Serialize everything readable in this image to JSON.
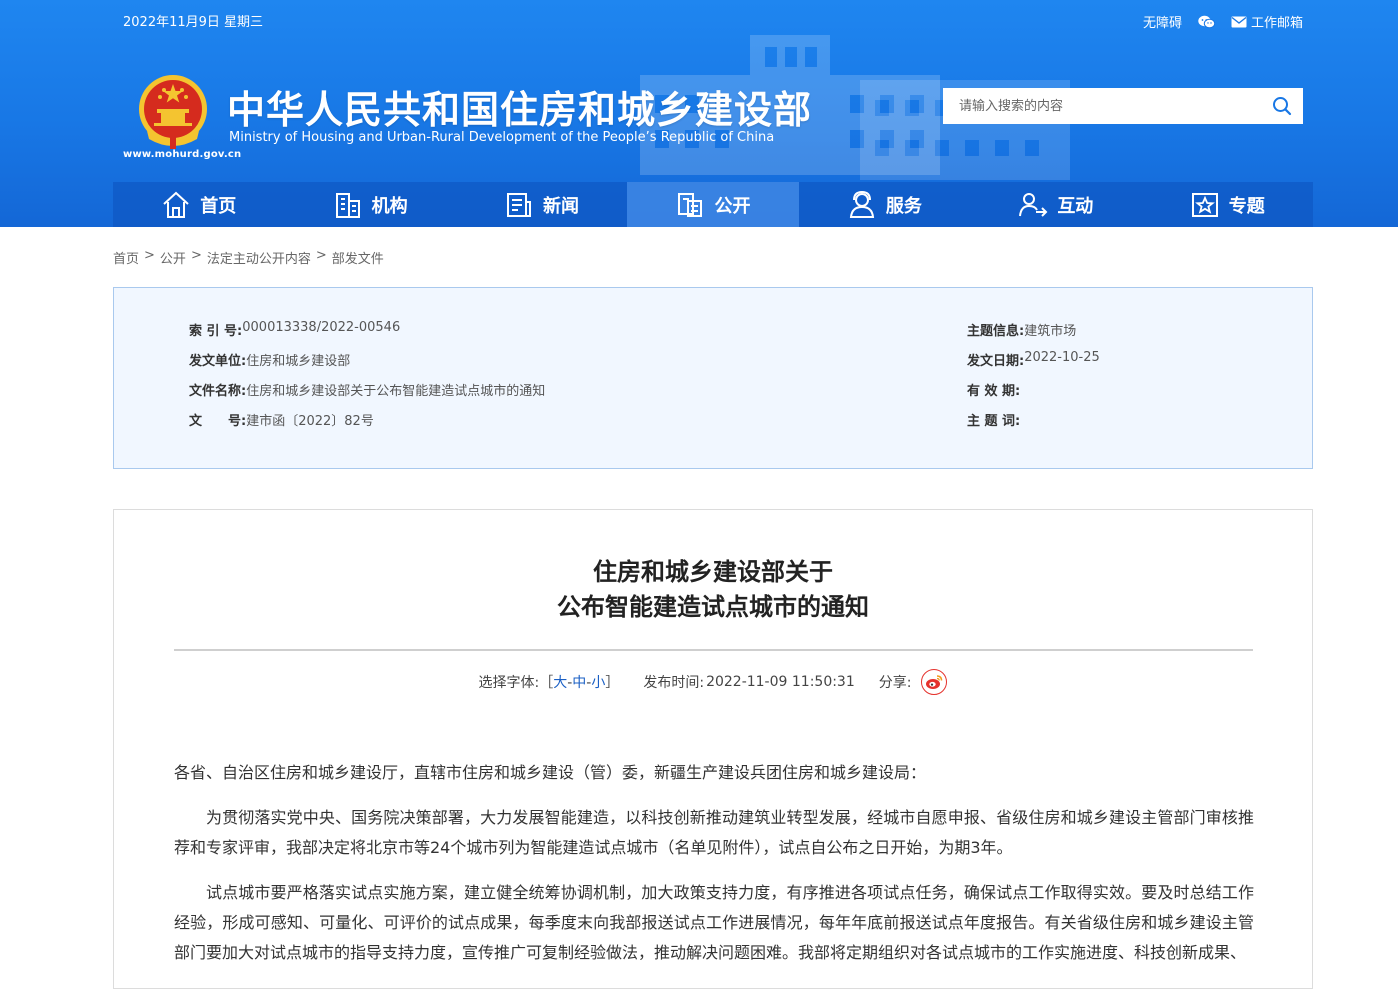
{
  "topbar": {
    "date": "2022年11月9日 星期三",
    "accessibility": "无障碍",
    "wechat_icon": "wechat-icon",
    "mail_label": "工作邮箱"
  },
  "site": {
    "url": "www.mohurd.gov.cn",
    "title_cn": "中华人民共和国住房和城乡建设部",
    "title_en": "Ministry of Housing and Urban-Rural Development of the People’s Republic of China"
  },
  "search": {
    "placeholder": "请输入搜索的内容"
  },
  "nav": [
    {
      "label": "首页",
      "icon": "home-icon"
    },
    {
      "label": "机构",
      "icon": "building-icon"
    },
    {
      "label": "新闻",
      "icon": "news-icon"
    },
    {
      "label": "公开",
      "icon": "open-doc-icon",
      "active": true
    },
    {
      "label": "服务",
      "icon": "service-icon"
    },
    {
      "label": "互动",
      "icon": "interact-icon"
    },
    {
      "label": "专题",
      "icon": "topic-icon"
    }
  ],
  "breadcrumb": [
    "首页",
    "公开",
    "法定主动公开内容",
    "部发文件"
  ],
  "info": {
    "index_label": "索 引 号:",
    "index_value": "000013338/2022-00546",
    "issuer_label": "发文单位:",
    "issuer_value": "住房和城乡建设部",
    "filename_label": "文件名称:",
    "filename_value": "住房和城乡建设部关于公布智能建造试点城市的通知",
    "docno_label": "文　　号:",
    "docno_value": "建市函〔2022〕82号",
    "topic_label": "主题信息:",
    "topic_value": "建筑市场",
    "date_label": "发文日期:",
    "date_value": "2022-10-25",
    "validity_label": "有 效 期:",
    "validity_value": "",
    "keywords_label": "主 题 词:",
    "keywords_value": ""
  },
  "article": {
    "title_line1": "住房和城乡建设部关于",
    "title_line2": "公布智能建造试点城市的通知",
    "font_label": "选择字体:［",
    "font_large": "大",
    "font_medium": "中",
    "font_small": "小",
    "font_close": "］",
    "font_dash": "-",
    "publish_label": "发布时间:",
    "publish_time": "2022-11-09 11:50:31",
    "share_label": "分享:",
    "share_icon": "weibo-icon",
    "addressee": "各省、自治区住房和城乡建设厅，直辖市住房和城乡建设（管）委，新疆生产建设兵团住房和城乡建设局：",
    "para1": "为贯彻落实党中央、国务院决策部署，大力发展智能建造，以科技创新推动建筑业转型发展，经城市自愿申报、省级住房和城乡建设主管部门审核推荐和专家评审，我部决定将北京市等24个城市列为智能建造试点城市（名单见附件），试点自公布之日开始，为期3年。",
    "para2": "试点城市要严格落实试点实施方案，建立健全统筹协调机制，加大政策支持力度，有序推进各项试点任务，确保试点工作取得实效。要及时总结工作经验，形成可感知、可量化、可评价的试点成果，每季度末向我部报送试点工作进展情况，每年年底前报送试点年度报告。有关省级住房和城乡建设主管部门要加大对试点城市的指导支持力度，宣传推广可复制经验做法，推动解决问题困难。我部将定期组织对各试点城市的工作实施进度、科技创新成果、"
  },
  "colors": {
    "header_blue": "#1877e5",
    "nav_active": "#5aa0f5",
    "link_blue": "#1a5fc4",
    "weibo_red": "#e5322d"
  }
}
